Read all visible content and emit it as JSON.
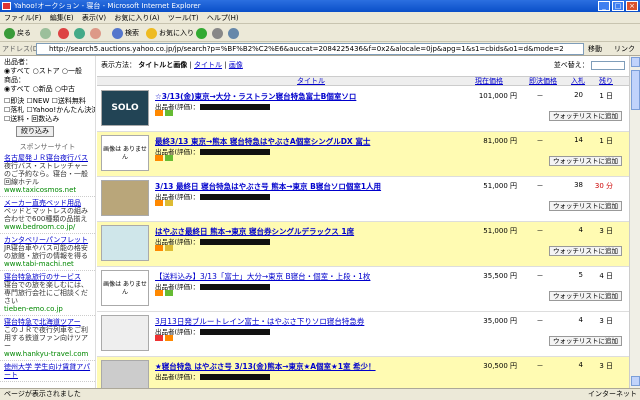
{
  "window": {
    "title": "Yahoo!オークション - 寝台 - Microsoft Internet Explorer"
  },
  "menubar": {
    "items": [
      "ファイル(F)",
      "編集(E)",
      "表示(V)",
      "お気に入り(A)",
      "ツール(T)",
      "ヘルプ(H)"
    ]
  },
  "toolbar": {
    "back": "戻る",
    "search": "検索",
    "favorites": "お気に入り"
  },
  "address": {
    "label": "アドレス(D)",
    "url": "http://search5.auctions.yahoo.co.jp/jp/search?p=%BF%B2%C2%E6&auccat=2084225436&f=0x2&alocale=0jp&apg=1&s1=cbids&o1=d&mode=2",
    "go": "移動",
    "links": "リンク"
  },
  "sidebar": {
    "title": "出品者：",
    "seller_opts": [
      "すべて",
      "ストア",
      "一般"
    ],
    "cond_title": "商品：",
    "cond_opts": [
      "すべて",
      "新品",
      "中古"
    ],
    "checks": [
      "即決",
      "NEW",
      "送料無料",
      "落札",
      "Yahoo!かんたん決済",
      "送料・回数込み"
    ],
    "refine_button": "絞り込み",
    "sponsor": "スポンサーサイト",
    "ads": [
      {
        "title": "名古屋発ＪＲ寝台夜行バス",
        "desc": "夜行バス・ストレッチャーのご予約なら。寝台・一般回線ホテル",
        "url": "www.taxicosmos.net"
      },
      {
        "title": "メーカー直売ベッド用品",
        "desc": "ベッドとマットレスの組み合わせで600種類の品揃え",
        "url": "www.bedroom.co.jp/"
      },
      {
        "title": "カンタベリーパンフレット",
        "desc": "JR寝台車やバス可能の格安の旅館・旅行の情報を得る",
        "url": "www.tabi-machi.net"
      },
      {
        "title": "寝台特急旅行のサービス",
        "desc": "寝台での旅を楽しむには、専門旅行会社にご相談ください",
        "url": "tieben-emo.co.jp"
      },
      {
        "title": "寝台特急で北海道ツアー",
        "desc": "このＪＲで夜行列車をご利用する鉄道ファン向けツアー",
        "url": "www.hankyu-travel.com"
      },
      {
        "title": "徳州大学 学生向け賃貸アパート",
        "desc": "",
        "url": ""
      }
    ]
  },
  "main": {
    "view_label": "表示方法：",
    "view_modes": [
      "タイトルと画像",
      "タイトル",
      "画像"
    ],
    "sort_label": "並べ替え：",
    "headers": {
      "title": "タイトル",
      "price": "現在価格",
      "bidnow": "即決価格",
      "bids": "入札",
      "remain": "残り"
    },
    "watch_label": "ウォッチリストに追加",
    "rows": [
      {
        "title": "☆3/13(金)東京→大分・ラストラン寝台特急富士B個室ソロ",
        "seller": "出品者(評価)：",
        "price": "101,000 円",
        "bidnow": "－",
        "bids": "20",
        "remain": "1 日",
        "img": "SOLO",
        "highlight": false
      },
      {
        "title": "最終3/13 東京→熊本 寝台特急はやぶさA個室シングルDX 富士",
        "seller": "出品者(評価)：",
        "price": "81,000 円",
        "bidnow": "－",
        "bids": "14",
        "remain": "1 日",
        "img": "画像は\nありません",
        "highlight": true
      },
      {
        "title": "3/13 最終日 寝台特急はやぶさ号 熊本→東京 B寝台ソロ個室1人用",
        "seller": "出品者(評価)：",
        "price": "51,000 円",
        "bidnow": "－",
        "bids": "38",
        "remain": "30 分",
        "img": "",
        "highlight": false
      },
      {
        "title": "はやぶさ最終日 熊本→東京 寝台券シングルデラックス 1席",
        "seller": "出品者(評価)：",
        "price": "51,000 円",
        "bidnow": "－",
        "bids": "4",
        "remain": "3 日",
        "img": "",
        "highlight": true
      },
      {
        "title": "【送料込み】3/13「富士」大分→東京 B寝台・個室・上段・1枚",
        "seller": "出品者(評価)：",
        "price": "35,500 円",
        "bidnow": "－",
        "bids": "5",
        "remain": "4 日",
        "img": "画像は\nありません",
        "highlight": false
      },
      {
        "title": "3月13日発ブルートレイン富士・はやぶさ下りソロ寝台特急券",
        "seller": "出品者(評価)：",
        "price": "35,000 円",
        "bidnow": "－",
        "bids": "4",
        "remain": "3 日",
        "img": "",
        "highlight": false
      },
      {
        "title": "★寝台特急 はやぶさ号 3/13(金)熊本→東京★A個室★1室 希少！",
        "seller": "出品者(評価)：",
        "price": "30,500 円",
        "bidnow": "－",
        "bids": "4",
        "remain": "3 日",
        "img": "",
        "highlight": true
      }
    ]
  },
  "status": {
    "done": "ページが表示されました",
    "zone": "インターネット"
  }
}
